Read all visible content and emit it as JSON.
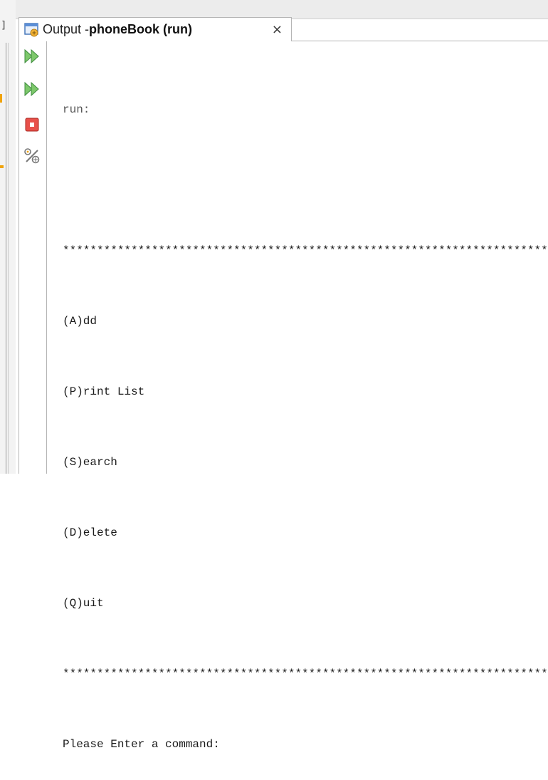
{
  "left_panel": {
    "mark": "]"
  },
  "tab": {
    "title_prefix": "Output - ",
    "title_bold": "phoneBook (run)",
    "close_glyph": "×"
  },
  "toolbar": {
    "buttons": [
      {
        "name": "rerun-icon",
        "color": "#4caf50"
      },
      {
        "name": "rerun-with-different-parameters-icon",
        "color": "#4caf50"
      },
      {
        "name": "stop-icon",
        "color": "#e53935"
      },
      {
        "name": "settings-icon",
        "color": "#777777"
      }
    ]
  },
  "console": {
    "lines": [
      "run:",
      "",
      "****************************************************************************",
      "(A)dd",
      "(P)rint List",
      "(S)earch",
      "(D)elete",
      "(Q)uit",
      "****************************************************************************",
      "Please Enter a command:"
    ]
  }
}
